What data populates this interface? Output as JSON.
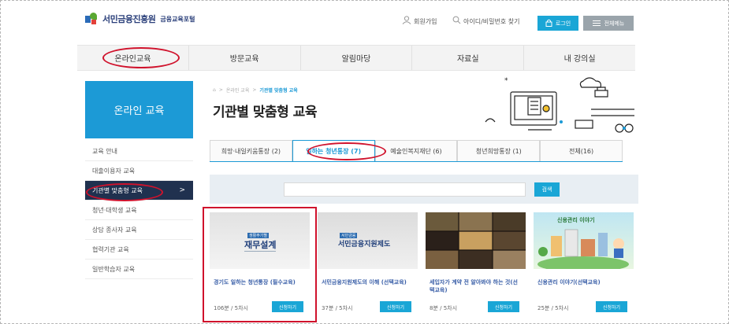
{
  "header": {
    "logo_name": "서민금융진흥원",
    "logo_sub": "금융교육포털",
    "signup": "회원가입",
    "find_id": "아이디/비밀번호 찾기",
    "login": "로그인",
    "all_menu": "전체메뉴"
  },
  "mainnav": {
    "items": [
      "온라인교육",
      "방문교육",
      "알림마당",
      "자료실",
      "내 강의실"
    ]
  },
  "sidebar": {
    "title": "온라인 교육",
    "items": [
      "교육 안내",
      "대출이용자 교육",
      "기관별 맞춤형 교육",
      "청년·대학생 교육",
      "상담 종사자 교육",
      "협력기관 교육",
      "일반학습자 교육"
    ],
    "active_arrow": ">"
  },
  "breadcrumb": {
    "home": "⌂",
    "sep": ">",
    "level1": "온라인 교육",
    "current": "기관별 맞춤형 교육"
  },
  "page_title": "기관별 맞춤형 교육",
  "tabs": [
    "희망·내일키움통장 (2)",
    "일하는 청년통장 (7)",
    "예술인복지재단 (6)",
    "청년희망통장 (1)",
    "전체(16)"
  ],
  "search": {
    "placeholder": "",
    "button": "검색"
  },
  "cards": [
    {
      "thumb_kicker": "생활주기별",
      "thumb_title": "재무설계",
      "title": "경기도 일하는 청년통장 (필수교육)",
      "meta": "106분 / 5차시",
      "button": "신청하기"
    },
    {
      "thumb_kicker": "서민금융",
      "thumb_title": "서민금융지원제도",
      "title": "서민금융지원제도의 이해 (선택교육)",
      "meta": "37분 / 5차시",
      "button": "신청하기"
    },
    {
      "title": "세입자가 계약 전 알아봐야 하는 것(선택교육)",
      "meta": "8분 / 5차시",
      "button": "신청하기"
    },
    {
      "thumb_title": "신용관리 이야기",
      "title": "신용관리 이야기(선택교육)",
      "meta": "25분 / 5차시",
      "button": "신청하기"
    }
  ],
  "colors": {
    "accent": "#1aa6d6",
    "sidebar_head": "#1c9ad6",
    "sidebar_active": "#20314f",
    "annotation_red": "#d0122c"
  }
}
